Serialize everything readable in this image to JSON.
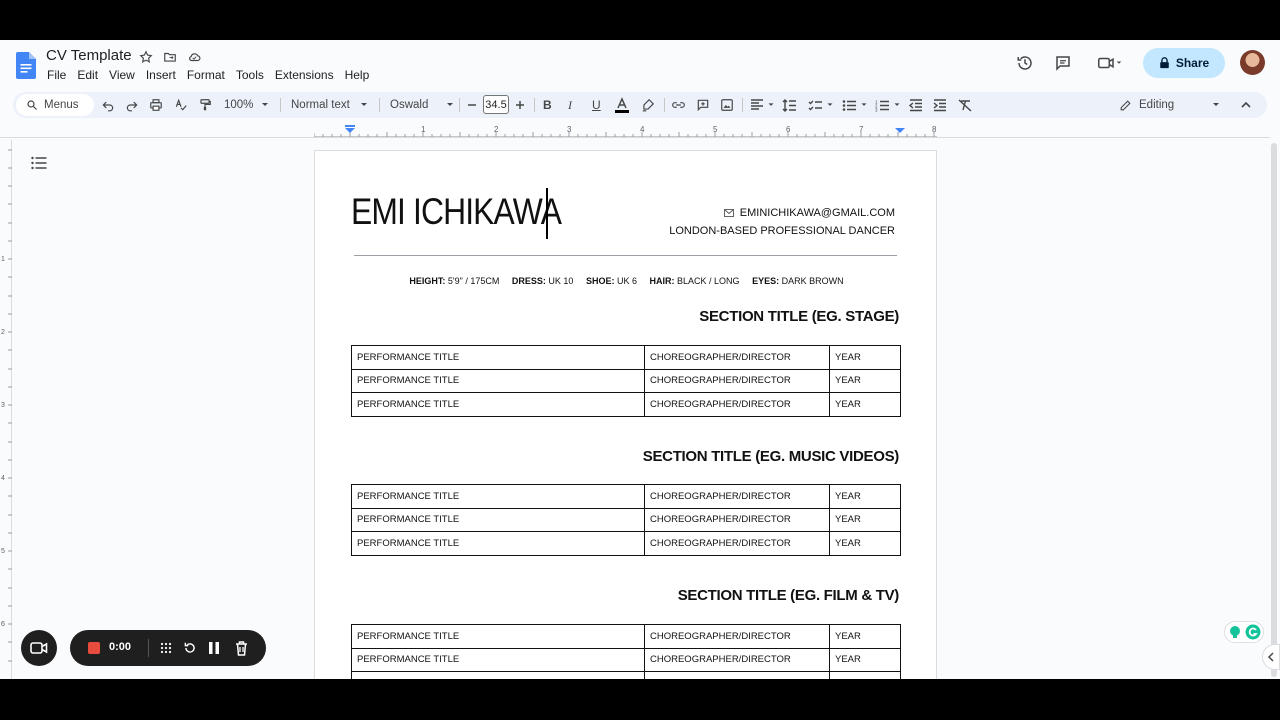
{
  "app": {
    "doc_title": "CV Template",
    "menu": [
      "File",
      "Edit",
      "View",
      "Insert",
      "Format",
      "Tools",
      "Extensions",
      "Help"
    ],
    "share_label": "Share"
  },
  "toolbar": {
    "search_label": "Menus",
    "zoom": "100%",
    "style": "Normal text",
    "font": "Oswald",
    "font_size": "34.5",
    "mode": "Editing"
  },
  "ruler": {
    "numbers": [
      "1",
      "2",
      "3",
      "4",
      "5",
      "6",
      "7",
      "8"
    ],
    "vnumbers": [
      "1",
      "2",
      "3",
      "4",
      "5",
      "6"
    ]
  },
  "cv": {
    "name": "EMI ICHIKAWA",
    "email": "EMINICHIKAWA@GMAIL.COM",
    "tagline": "LONDON-BASED PROFESSIONAL DANCER",
    "stats": [
      {
        "label": "HEIGHT:",
        "value": "5'9\" / 175CM"
      },
      {
        "label": "DRESS:",
        "value": "UK 10"
      },
      {
        "label": "SHOE:",
        "value": "UK 6"
      },
      {
        "label": "HAIR:",
        "value": "BLACK / LONG"
      },
      {
        "label": "EYES:",
        "value": "DARK BROWN"
      }
    ],
    "sections": [
      {
        "title": "SECTION TITLE (EG. STAGE)",
        "rows": [
          [
            "PERFORMANCE TITLE",
            "CHOREOGRAPHER/DIRECTOR",
            "YEAR"
          ],
          [
            "PERFORMANCE TITLE",
            "CHOREOGRAPHER/DIRECTOR",
            "YEAR"
          ],
          [
            "PERFORMANCE TITLE",
            "CHOREOGRAPHER/DIRECTOR",
            "YEAR"
          ]
        ]
      },
      {
        "title": "SECTION TITLE (EG. MUSIC VIDEOS)",
        "rows": [
          [
            "PERFORMANCE TITLE",
            "CHOREOGRAPHER/DIRECTOR",
            "YEAR"
          ],
          [
            "PERFORMANCE TITLE",
            "CHOREOGRAPHER/DIRECTOR",
            "YEAR"
          ],
          [
            "PERFORMANCE TITLE",
            "CHOREOGRAPHER/DIRECTOR",
            "YEAR"
          ]
        ]
      },
      {
        "title": "SECTION TITLE (EG. FILM & TV)",
        "rows": [
          [
            "PERFORMANCE TITLE",
            "CHOREOGRAPHER/DIRECTOR",
            "YEAR"
          ],
          [
            "PERFORMANCE TITLE",
            "CHOREOGRAPHER/DIRECTOR",
            "YEAR"
          ],
          [
            "",
            "",
            ""
          ]
        ]
      }
    ]
  },
  "recorder": {
    "time": "0:00"
  },
  "colors": {
    "share_bg": "#c2e7ff",
    "toolbar_bg": "#edf2fa",
    "rec_stop": "#e84c3d",
    "docs_blue": "#4285f4"
  }
}
